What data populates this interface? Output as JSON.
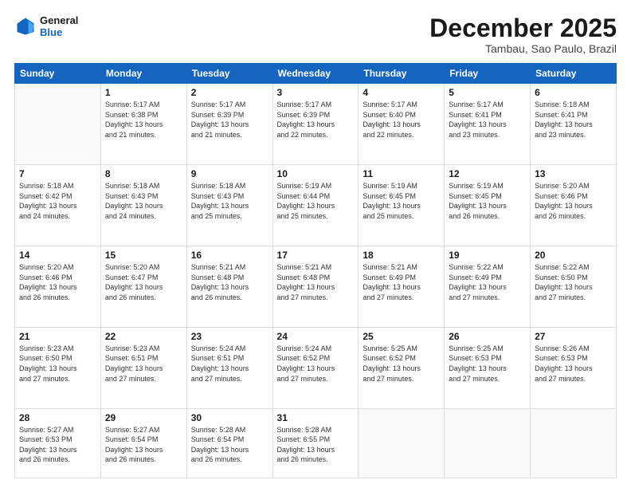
{
  "logo": {
    "line1": "General",
    "line2": "Blue"
  },
  "header": {
    "month": "December 2025",
    "location": "Tambau, Sao Paulo, Brazil"
  },
  "weekdays": [
    "Sunday",
    "Monday",
    "Tuesday",
    "Wednesday",
    "Thursday",
    "Friday",
    "Saturday"
  ],
  "weeks": [
    [
      {
        "day": "",
        "info": ""
      },
      {
        "day": "1",
        "info": "Sunrise: 5:17 AM\nSunset: 6:38 PM\nDaylight: 13 hours\nand 21 minutes."
      },
      {
        "day": "2",
        "info": "Sunrise: 5:17 AM\nSunset: 6:39 PM\nDaylight: 13 hours\nand 21 minutes."
      },
      {
        "day": "3",
        "info": "Sunrise: 5:17 AM\nSunset: 6:39 PM\nDaylight: 13 hours\nand 22 minutes."
      },
      {
        "day": "4",
        "info": "Sunrise: 5:17 AM\nSunset: 6:40 PM\nDaylight: 13 hours\nand 22 minutes."
      },
      {
        "day": "5",
        "info": "Sunrise: 5:17 AM\nSunset: 6:41 PM\nDaylight: 13 hours\nand 23 minutes."
      },
      {
        "day": "6",
        "info": "Sunrise: 5:18 AM\nSunset: 6:41 PM\nDaylight: 13 hours\nand 23 minutes."
      }
    ],
    [
      {
        "day": "7",
        "info": "Sunrise: 5:18 AM\nSunset: 6:42 PM\nDaylight: 13 hours\nand 24 minutes."
      },
      {
        "day": "8",
        "info": "Sunrise: 5:18 AM\nSunset: 6:43 PM\nDaylight: 13 hours\nand 24 minutes."
      },
      {
        "day": "9",
        "info": "Sunrise: 5:18 AM\nSunset: 6:43 PM\nDaylight: 13 hours\nand 25 minutes."
      },
      {
        "day": "10",
        "info": "Sunrise: 5:19 AM\nSunset: 6:44 PM\nDaylight: 13 hours\nand 25 minutes."
      },
      {
        "day": "11",
        "info": "Sunrise: 5:19 AM\nSunset: 6:45 PM\nDaylight: 13 hours\nand 25 minutes."
      },
      {
        "day": "12",
        "info": "Sunrise: 5:19 AM\nSunset: 6:45 PM\nDaylight: 13 hours\nand 26 minutes."
      },
      {
        "day": "13",
        "info": "Sunrise: 5:20 AM\nSunset: 6:46 PM\nDaylight: 13 hours\nand 26 minutes."
      }
    ],
    [
      {
        "day": "14",
        "info": "Sunrise: 5:20 AM\nSunset: 6:46 PM\nDaylight: 13 hours\nand 26 minutes."
      },
      {
        "day": "15",
        "info": "Sunrise: 5:20 AM\nSunset: 6:47 PM\nDaylight: 13 hours\nand 26 minutes."
      },
      {
        "day": "16",
        "info": "Sunrise: 5:21 AM\nSunset: 6:48 PM\nDaylight: 13 hours\nand 26 minutes."
      },
      {
        "day": "17",
        "info": "Sunrise: 5:21 AM\nSunset: 6:48 PM\nDaylight: 13 hours\nand 27 minutes."
      },
      {
        "day": "18",
        "info": "Sunrise: 5:21 AM\nSunset: 6:49 PM\nDaylight: 13 hours\nand 27 minutes."
      },
      {
        "day": "19",
        "info": "Sunrise: 5:22 AM\nSunset: 6:49 PM\nDaylight: 13 hours\nand 27 minutes."
      },
      {
        "day": "20",
        "info": "Sunrise: 5:22 AM\nSunset: 6:50 PM\nDaylight: 13 hours\nand 27 minutes."
      }
    ],
    [
      {
        "day": "21",
        "info": "Sunrise: 5:23 AM\nSunset: 6:50 PM\nDaylight: 13 hours\nand 27 minutes."
      },
      {
        "day": "22",
        "info": "Sunrise: 5:23 AM\nSunset: 6:51 PM\nDaylight: 13 hours\nand 27 minutes."
      },
      {
        "day": "23",
        "info": "Sunrise: 5:24 AM\nSunset: 6:51 PM\nDaylight: 13 hours\nand 27 minutes."
      },
      {
        "day": "24",
        "info": "Sunrise: 5:24 AM\nSunset: 6:52 PM\nDaylight: 13 hours\nand 27 minutes."
      },
      {
        "day": "25",
        "info": "Sunrise: 5:25 AM\nSunset: 6:52 PM\nDaylight: 13 hours\nand 27 minutes."
      },
      {
        "day": "26",
        "info": "Sunrise: 5:25 AM\nSunset: 6:53 PM\nDaylight: 13 hours\nand 27 minutes."
      },
      {
        "day": "27",
        "info": "Sunrise: 5:26 AM\nSunset: 6:53 PM\nDaylight: 13 hours\nand 27 minutes."
      }
    ],
    [
      {
        "day": "28",
        "info": "Sunrise: 5:27 AM\nSunset: 6:53 PM\nDaylight: 13 hours\nand 26 minutes."
      },
      {
        "day": "29",
        "info": "Sunrise: 5:27 AM\nSunset: 6:54 PM\nDaylight: 13 hours\nand 26 minutes."
      },
      {
        "day": "30",
        "info": "Sunrise: 5:28 AM\nSunset: 6:54 PM\nDaylight: 13 hours\nand 26 minutes."
      },
      {
        "day": "31",
        "info": "Sunrise: 5:28 AM\nSunset: 6:55 PM\nDaylight: 13 hours\nand 26 minutes."
      },
      {
        "day": "",
        "info": ""
      },
      {
        "day": "",
        "info": ""
      },
      {
        "day": "",
        "info": ""
      }
    ]
  ]
}
